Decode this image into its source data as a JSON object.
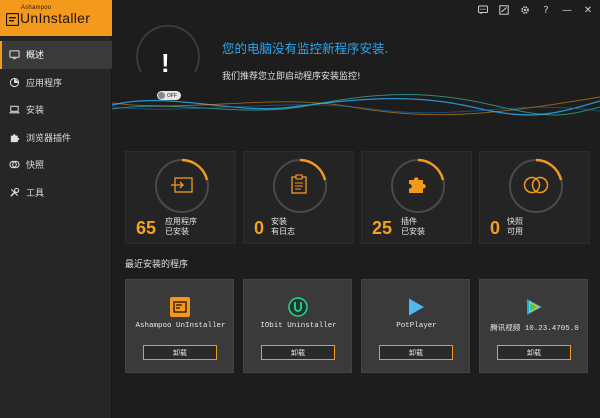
{
  "app": {
    "logo_small": "Ashampoo",
    "logo_big": "UnInstaller",
    "brand_color": "#f39a1d",
    "accent_blue": "#2aa6ee"
  },
  "topbar": {
    "icons": [
      "chat-icon",
      "note-icon",
      "gear-icon",
      "help-icon",
      "minimize-icon",
      "close-icon"
    ],
    "help_glyph": "?",
    "minimize_glyph": "—",
    "close_glyph": "✕"
  },
  "sidebar": {
    "items": [
      {
        "label": "概述",
        "icon": "monitor-icon",
        "active": true
      },
      {
        "label": "应用程序",
        "icon": "apps-icon",
        "active": false
      },
      {
        "label": "安装",
        "icon": "laptop-icon",
        "active": false
      },
      {
        "label": "浏览器插件",
        "icon": "puzzle-icon",
        "active": false
      },
      {
        "label": "快照",
        "icon": "snapshot-icon",
        "active": false
      },
      {
        "label": "工具",
        "icon": "tools-icon",
        "active": false
      }
    ]
  },
  "header": {
    "alert_glyph": "!",
    "toggle_label": "OFF",
    "headline": "您的电脑没有监控新程序安装.",
    "subline": "我们推荐您立即启动程序安装监控!"
  },
  "stats": [
    {
      "value": "65",
      "line1": "应用程序",
      "line2": "已安装",
      "icon": "install-icon"
    },
    {
      "value": "0",
      "line1": "安装",
      "line2": "有日志",
      "icon": "clipboard-icon"
    },
    {
      "value": "25",
      "line1": "插件",
      "line2": "已安装",
      "icon": "puzzle-icon"
    },
    {
      "value": "0",
      "line1": "快照",
      "line2": "可用",
      "icon": "snapshot-icon"
    }
  ],
  "recent": {
    "title": "最近安装的程序",
    "apps": [
      {
        "name": "Ashampoo UnInstaller",
        "button": "卸载",
        "icon": "ashampoo-icon"
      },
      {
        "name": "IObit Uninstaller",
        "button": "卸载",
        "icon": "iobit-icon"
      },
      {
        "name": "PotPlayer",
        "button": "卸载",
        "icon": "potplayer-icon"
      },
      {
        "name": "腾讯视频 10.23.4705.0",
        "button": "卸载",
        "icon": "tencent-video-icon"
      }
    ]
  }
}
